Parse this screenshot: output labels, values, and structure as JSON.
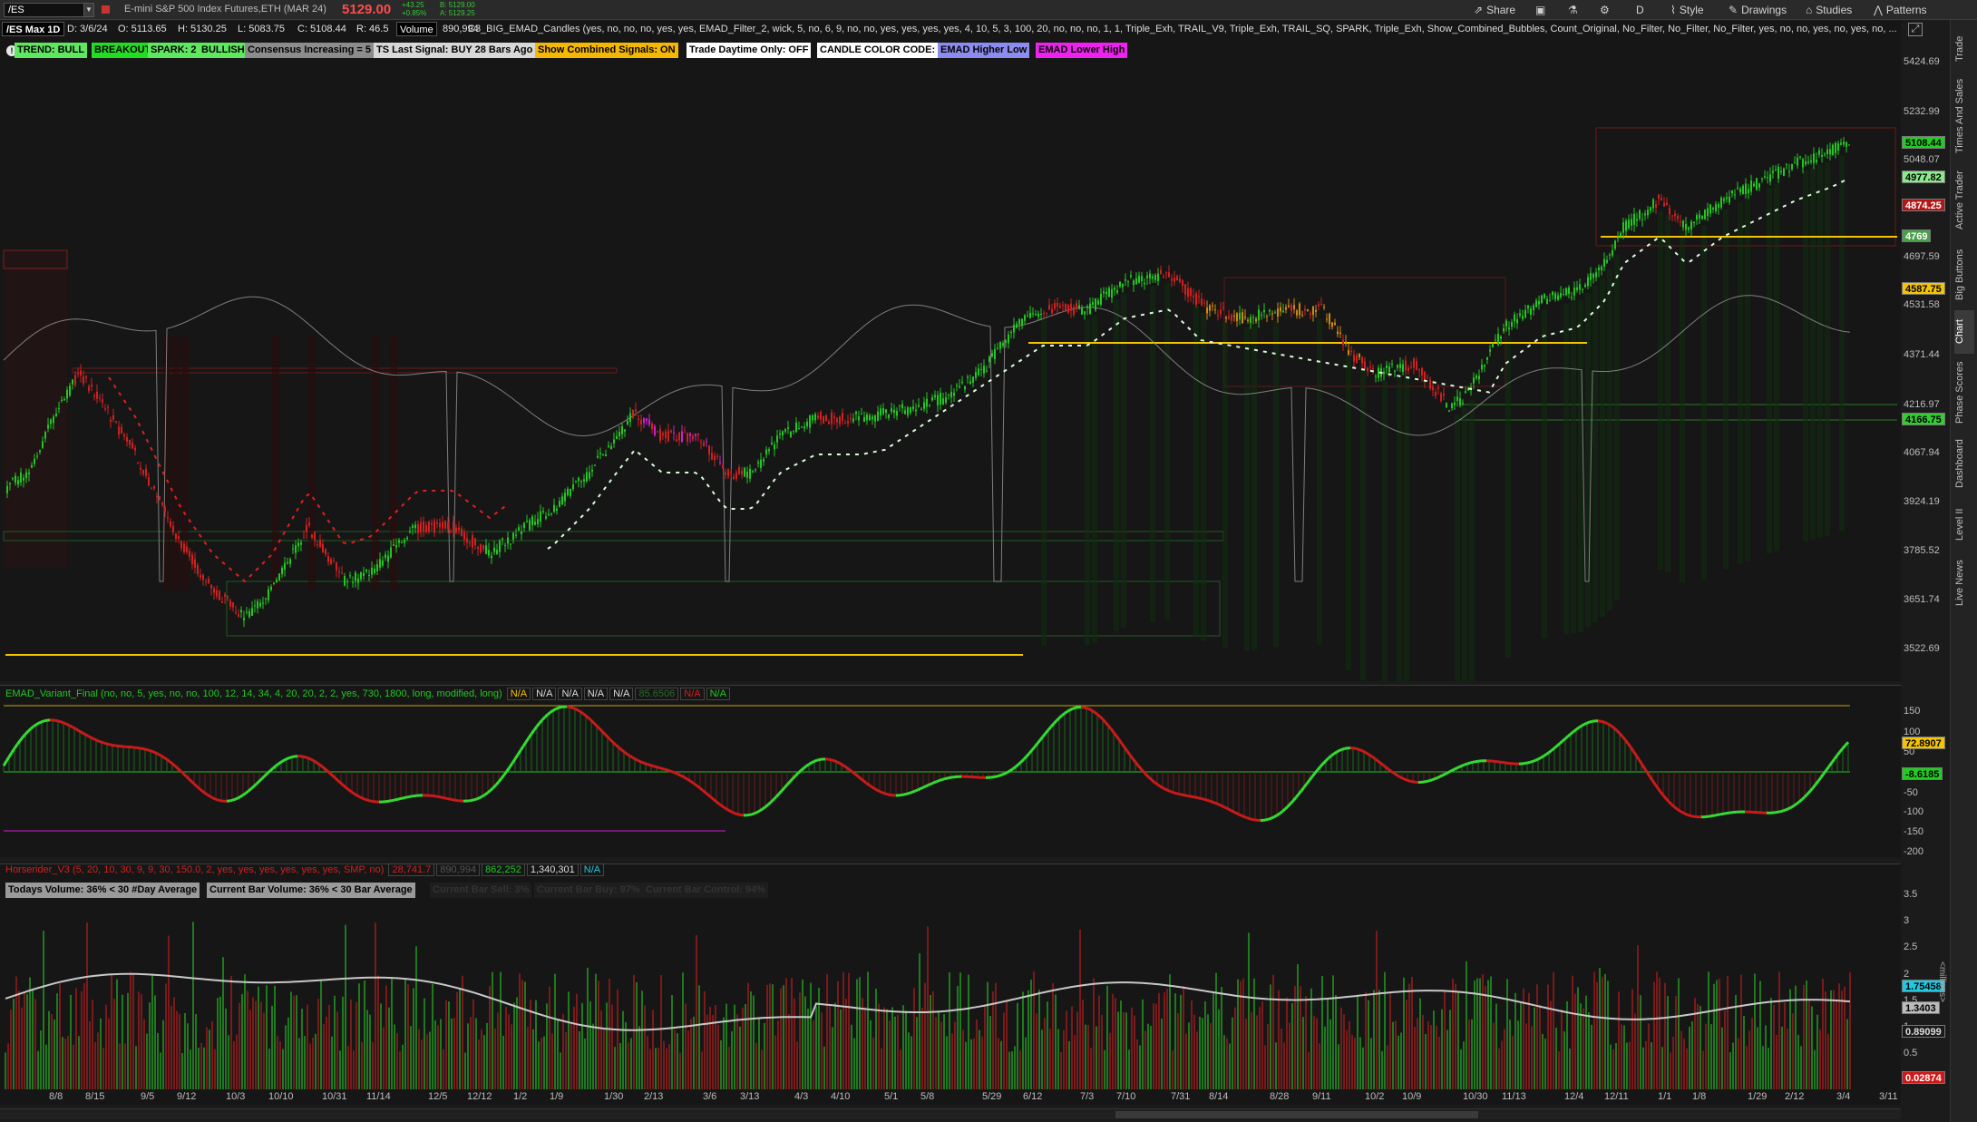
{
  "toolbar": {
    "symbol": "/ES",
    "instrument": "E-mini S&P 500 Index Futures,ETH (MAR 24)",
    "last_price": "5129.00",
    "change_line1": "+43.25",
    "change_line2": "+0.85%",
    "bid_line": "B: 5129.00",
    "ask_line": "A: 5129.25",
    "share_label": "Share",
    "timeframe": "D",
    "style_label": "Style",
    "drawings_label": "Drawings",
    "studies_label": "Studies",
    "patterns_label": "Patterns"
  },
  "header": {
    "title": "/ES Max 1D",
    "date": "D: 3/6/24",
    "open": "O: 5113.65",
    "high": "H: 5130.25",
    "low": "L: 5083.75",
    "close": "C: 5108.44",
    "range": "R: 46.5",
    "volume_label": "Volume",
    "volume_value": "890,994",
    "study_text": "C3_BIG_EMAD_Candles (yes, no, no, no, yes, yes, EMAD_Filter_2, wick, 5, no, 6, 9, no, no, yes, yes, yes, yes, 4, 10, 5, 3, 100, 20, no, no, no, 1, 1, Triple_Exh, TRAIL_V9, Triple_Exh, TRAIL_SQ, SPARK, Triple_Exh, Show_Combined_Bubbles, Count_Original, No_Filter, No_Filter, No_Filter, yes, no, no, yes, no, yes, no, ..."
  },
  "badges": [
    {
      "text": "TREND: BULL",
      "bg": "#5ee85e"
    },
    {
      "text": "BREAKOUT",
      "bg": "#22dd22"
    },
    {
      "text": "SPARK: 2",
      "bg": "#5ee85e"
    },
    {
      "text": "BULLISH",
      "bg": "#5ee85e"
    },
    {
      "text": "Consensus Increasing = 5",
      "bg": "#8c8c8c"
    },
    {
      "text": "TS Last Signal: BUY 28 Bars Ago",
      "bg": "#d8d8d8"
    },
    {
      "text": "Show Combined Signals: ON",
      "bg": "#f5b800"
    },
    {
      "text": "Trade Daytime Only: OFF",
      "bg": "#ffffff"
    },
    {
      "text": "CANDLE COLOR CODE:",
      "bg": "#ffffff"
    },
    {
      "text": "EMAD Higher Low",
      "bg": "#8b8bf0"
    },
    {
      "text": "EMAD Lower High",
      "bg": "#ee22ee"
    }
  ],
  "price_axis": [
    "5424.69",
    "5232.99",
    "5048.07",
    "4697.59",
    "4531.58",
    "4371.44",
    "4216.97",
    "4067.94",
    "3924.19",
    "3785.52",
    "3651.74",
    "3522.69"
  ],
  "price_tags": [
    {
      "text": "5108.44",
      "bg": "#22cc22",
      "fg": "#000"
    },
    {
      "text": "4977.82",
      "bg": "#8be88b",
      "fg": "#000"
    },
    {
      "text": "4874.25",
      "bg": "#b01818",
      "fg": "#fff"
    },
    {
      "text": "4769",
      "bg": "#4aa04a",
      "fg": "#fff"
    },
    {
      "text": "4587.75",
      "bg": "#f5c400",
      "fg": "#000"
    },
    {
      "text": "4166.75",
      "bg": "#33cc33",
      "fg": "#000"
    }
  ],
  "oscillator": {
    "study": "EMAD_Variant_Final (no, no, 5, yes, no, no, 100, 12, 14, 34, 4, 20, 20, 2, 2, yes, 730, 1800, long, modified, long)",
    "values": [
      "N/A",
      "N/A",
      "N/A",
      "N/A",
      "N/A",
      "85.6506",
      "N/A",
      "N/A"
    ],
    "axis": [
      "150",
      "100",
      "50",
      "-50",
      "-100",
      "-150",
      "-200"
    ],
    "tags": [
      {
        "text": "72.8907",
        "bg": "#f5c400",
        "fg": "#000"
      },
      {
        "text": "-8.6185",
        "bg": "#22cc22",
        "fg": "#000"
      }
    ]
  },
  "volume": {
    "study": "Horserider_V3 (5, 20, 10, 30, 9, 9, 30, 150.0, 2, yes, yes, yes, yes, yes, yes, SMP, no)",
    "values": [
      "28,741.7",
      "890,994",
      "862,252",
      "1,340,301",
      "N/A"
    ],
    "badges": [
      {
        "text": "Todays Volume: 36% < 30 #Day Average",
        "bg": "#9a9a9a",
        "fg": "#000"
      },
      {
        "text": "Current Bar Volume: 36% < 30 Bar Average",
        "bg": "#9a9a9a",
        "fg": "#000"
      },
      {
        "text": "Current Bar Sell: 3%",
        "bg": "#1e1e1e",
        "fg": "#333"
      },
      {
        "text": "Current Bar Buy: 97%",
        "bg": "#1e1e1e",
        "fg": "#333"
      },
      {
        "text": "Current Bar Control: 94%",
        "bg": "#1e1e1e",
        "fg": "#333"
      }
    ],
    "axis": [
      "3.5",
      "3",
      "2.5",
      "2",
      "1.5",
      "1",
      "0.5"
    ],
    "unit": "<millions>",
    "tags": [
      {
        "text": "1.75458",
        "bg": "#22c8e0",
        "fg": "#000"
      },
      {
        "text": "1.3403",
        "bg": "#bbbbbb",
        "fg": "#000"
      },
      {
        "text": "0.89099",
        "bg": "#1a1a1a",
        "fg": "#ddd"
      },
      {
        "text": "0.02874",
        "bg": "#d01818",
        "fg": "#fff"
      }
    ]
  },
  "x_axis": [
    "8/8",
    "8/15",
    "9/5",
    "9/12",
    "10/3",
    "10/10",
    "10/31",
    "11/14",
    "12/5",
    "12/12",
    "1/2",
    "1/9",
    "1/30",
    "2/13",
    "3/6",
    "3/13",
    "4/3",
    "4/10",
    "5/1",
    "5/8",
    "5/29",
    "6/12",
    "7/3",
    "7/10",
    "7/31",
    "8/14",
    "8/28",
    "9/11",
    "10/2",
    "10/9",
    "10/30",
    "11/13",
    "12/4",
    "12/11",
    "1/1",
    "1/8",
    "1/29",
    "2/12",
    "3/4",
    "3/11"
  ],
  "sidebar": [
    "Trade",
    "Times And Sales",
    "Active Trader",
    "Big Buttons",
    "Chart",
    "Phase Scores",
    "Dashboard",
    "Level II",
    "Live News"
  ],
  "colors": {
    "bull": "#22c822",
    "bear": "#d02020",
    "accent": "#f5c400"
  }
}
